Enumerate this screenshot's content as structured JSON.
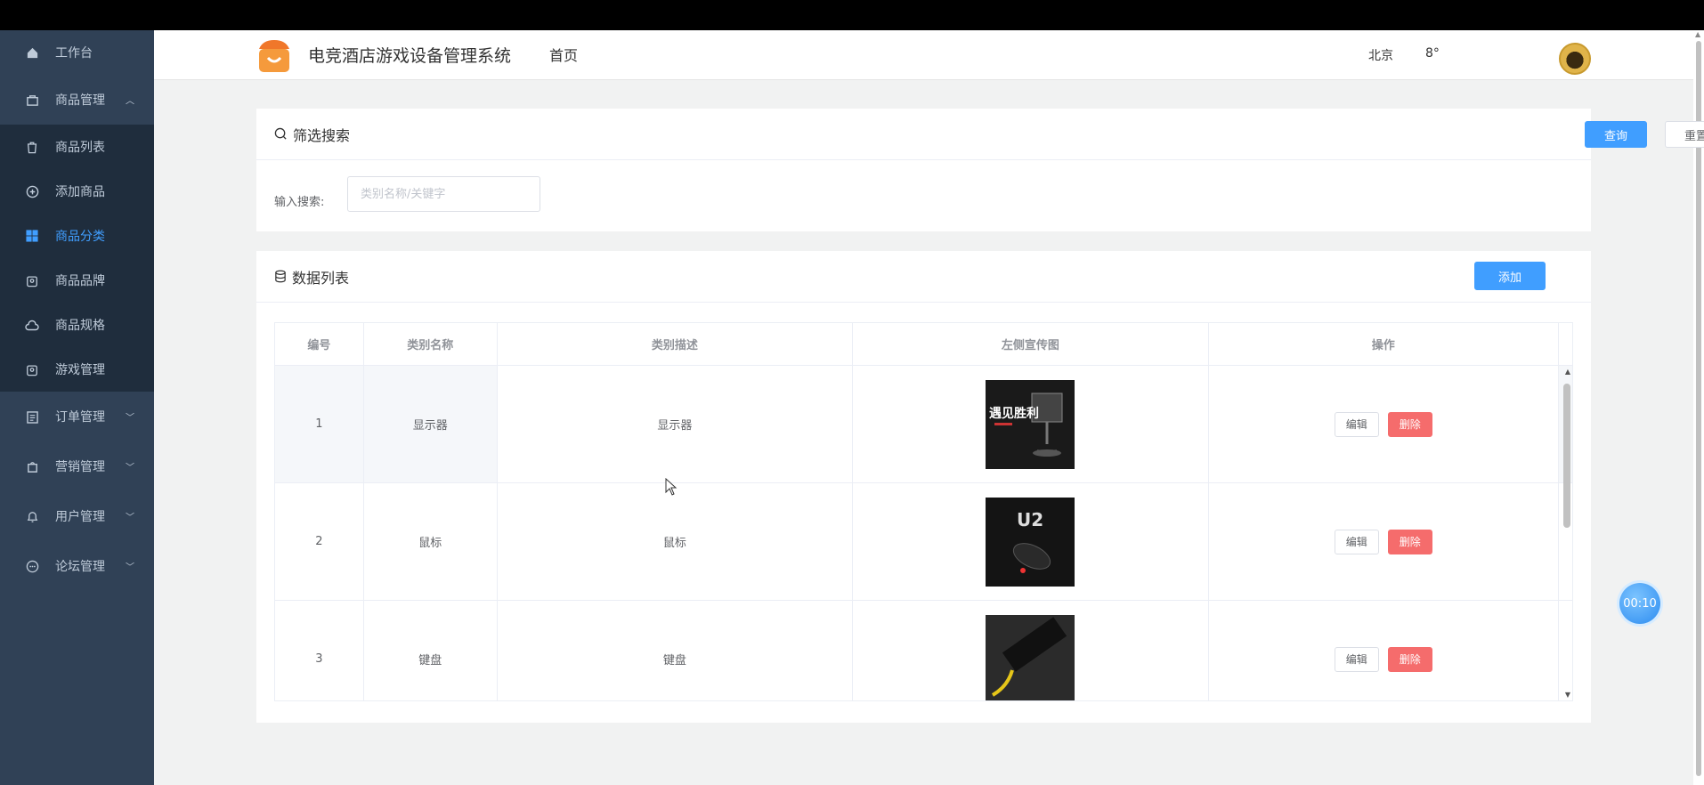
{
  "sidebar": {
    "items": [
      {
        "label": "工作台"
      },
      {
        "label": "商品管理"
      },
      {
        "label": "商品列表"
      },
      {
        "label": "添加商品"
      },
      {
        "label": "商品分类"
      },
      {
        "label": "商品品牌"
      },
      {
        "label": "商品规格"
      },
      {
        "label": "游戏管理"
      },
      {
        "label": "订单管理"
      },
      {
        "label": "营销管理"
      },
      {
        "label": "用户管理"
      },
      {
        "label": "论坛管理"
      }
    ],
    "active_color": "#409eff",
    "bg_color": "#304156"
  },
  "header": {
    "title": "电竞酒店游戏设备管理系统",
    "home": "首页",
    "city": "北京",
    "temperature": "8°"
  },
  "filter": {
    "title": "筛选搜索",
    "query_label": "查询",
    "reset_label": "重置",
    "search_label": "输入搜索:",
    "search_placeholder": "类别名称/关键字",
    "search_value": ""
  },
  "list": {
    "title": "数据列表",
    "add_label": "添加",
    "columns": [
      "编号",
      "类别名称",
      "类别描述",
      "左侧宣传图",
      "操作"
    ],
    "rows": [
      {
        "id": "1",
        "name": "显示器",
        "desc": "显示器",
        "image": "monitor-promo-image"
      },
      {
        "id": "2",
        "name": "鼠标",
        "desc": "鼠标",
        "image": "mouse-promo-image"
      },
      {
        "id": "3",
        "name": "键盘",
        "desc": "键盘",
        "image": "keyboard-promo-image"
      }
    ],
    "edit_label": "编辑",
    "delete_label": "删除",
    "image_text_1": "遇见胜利",
    "image_text_2": "U2"
  },
  "timer": "00:10"
}
